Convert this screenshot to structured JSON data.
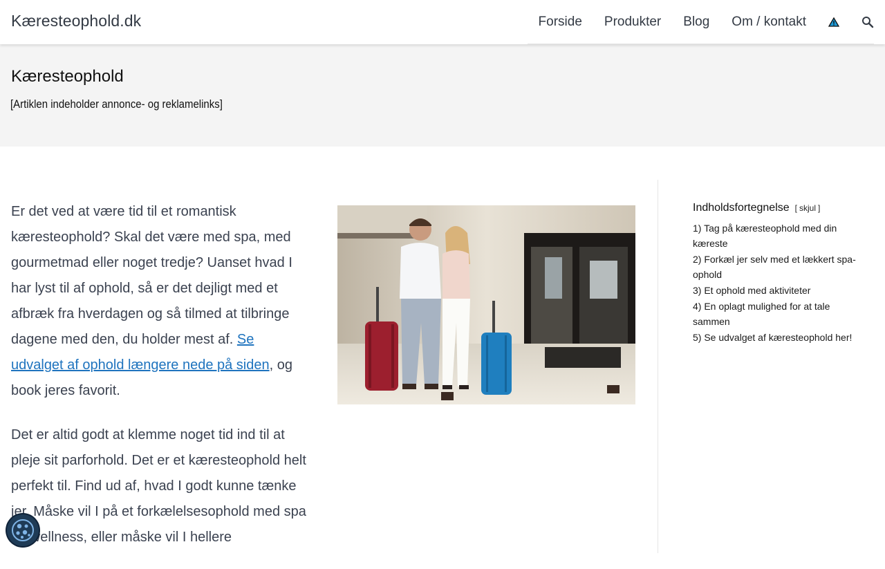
{
  "header": {
    "brand": "Kæresteophold.dk",
    "nav": [
      "Forside",
      "Produkter",
      "Blog",
      "Om / kontakt"
    ],
    "icons": [
      "warning-triangle-icon",
      "search-icon"
    ]
  },
  "title_band": {
    "title": "Kæresteophold",
    "disclaimer": "[Artiklen indeholder annonce- og reklamelinks]"
  },
  "content": {
    "p1_text": "Er det ved at være tid til et romantisk kæresteophold? Skal det være med spa, med gourmetmad eller noget tredje? Uanset hvad I har lyst til af ophold, så er det dejligt med et afbræk fra hverdagen og så tilmed at tilbringe dagene med den, du holder mest af. ",
    "p1_link": "Se udvalget af ophold længere nede på siden",
    "p1_tail": ", og book jeres favorit.",
    "p2_text": "Det er altid godt at klemme noget tid ind til at pleje sit parforhold. Det er et kæresteophold helt perfekt til. Find ud af, hvad I godt kunne tænke jer. Måske vil I på et forkælelsesophold med spa og wellness, eller måske vil I hellere"
  },
  "toc": {
    "title": "Indholdsfortegnelse",
    "toggle": "skjul",
    "items": [
      "1) Tag på kæresteophold med din kæreste",
      "2) Forkæl jer selv med et lækkert spa-ophold",
      "3) Et ophold med aktiviteter",
      "4) En oplagt mulighed for at tale sammen",
      "5) Se udvalget af kæresteophold her!"
    ]
  },
  "colors": {
    "link": "#1e73be",
    "title_band_bg": "#f4f4f4",
    "warning_icon": "#1e9ad6",
    "cookie_button": "#1f3b56"
  }
}
